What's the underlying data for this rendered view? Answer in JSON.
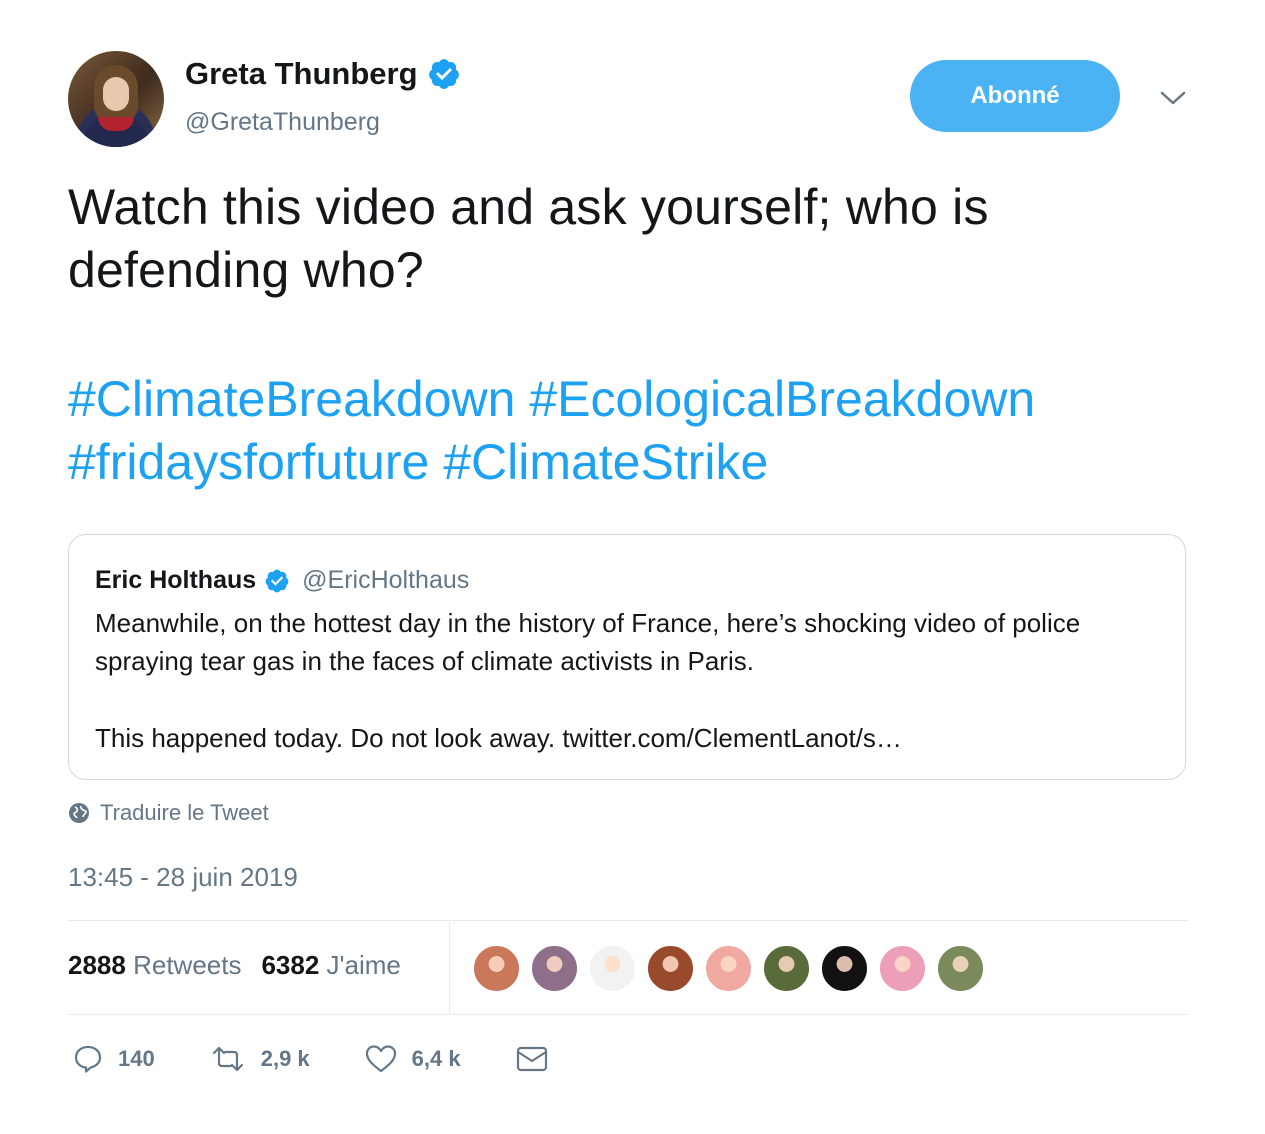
{
  "author": {
    "display_name": "Greta Thunberg",
    "handle": "@GretaThunberg",
    "verified_icon": "verified-badge-icon"
  },
  "follow_button": {
    "label": "Abonné"
  },
  "menu_icon": "chevron-down-icon",
  "tweet": {
    "text": "Watch this video and ask yourself; who is defending who?",
    "hashtags": [
      "#ClimateBreakdown",
      "#EcologicalBreakdown",
      "#fridaysforfuture",
      "#ClimateStrike"
    ]
  },
  "quoted_tweet": {
    "display_name": "Eric Holthaus",
    "handle": "@EricHolthaus",
    "text": "Meanwhile, on the hottest day in the history of France, here’s shocking video of police spraying tear gas in the faces of climate activists in Paris.",
    "text2": "This happened today. Do not look away. twitter.com/ClementLanot/s…"
  },
  "translate": {
    "label": "Traduire le Tweet",
    "icon": "globe-icon"
  },
  "timestamp": "13:45 - 28 juin 2019",
  "stats": {
    "retweets_count": "2888",
    "retweets_label": "Retweets",
    "likes_count": "6382",
    "likes_label": "J'aime"
  },
  "likers": [
    {
      "name": "liker-avatar-1",
      "color": "#c9795a"
    },
    {
      "name": "liker-avatar-2",
      "color": "#8e6f8a"
    },
    {
      "name": "liker-avatar-3",
      "color": "#f2f2f2"
    },
    {
      "name": "liker-avatar-4",
      "color": "#9a4a2c"
    },
    {
      "name": "liker-avatar-5",
      "color": "#f0a8a0"
    },
    {
      "name": "liker-avatar-6",
      "color": "#5a6b3a"
    },
    {
      "name": "liker-avatar-7",
      "color": "#111111"
    },
    {
      "name": "liker-avatar-8",
      "color": "#ee9fb8"
    },
    {
      "name": "liker-avatar-9",
      "color": "#7a8a5a"
    }
  ],
  "actions": {
    "reply_count": "140",
    "retweet_count": "2,9 k",
    "like_count": "6,4 k"
  },
  "colors": {
    "accent": "#1da1f2",
    "follow_button": "#4ab3f4",
    "secondary_text": "#657786",
    "primary_text": "#14171a"
  }
}
